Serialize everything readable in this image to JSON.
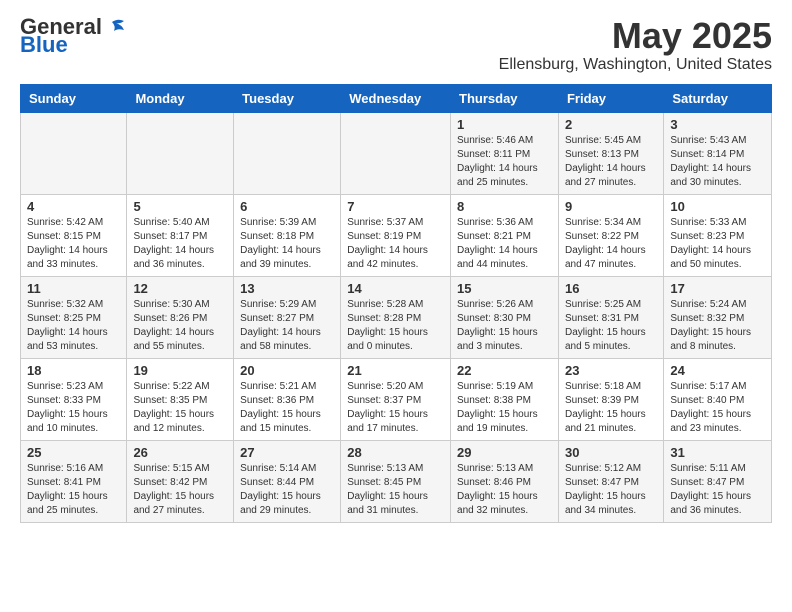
{
  "header": {
    "logo_general": "General",
    "logo_blue": "Blue",
    "month_title": "May 2025",
    "location": "Ellensburg, Washington, United States"
  },
  "days_of_week": [
    "Sunday",
    "Monday",
    "Tuesday",
    "Wednesday",
    "Thursday",
    "Friday",
    "Saturday"
  ],
  "weeks": [
    [
      {
        "num": "",
        "info": ""
      },
      {
        "num": "",
        "info": ""
      },
      {
        "num": "",
        "info": ""
      },
      {
        "num": "",
        "info": ""
      },
      {
        "num": "1",
        "info": "Sunrise: 5:46 AM\nSunset: 8:11 PM\nDaylight: 14 hours\nand 25 minutes."
      },
      {
        "num": "2",
        "info": "Sunrise: 5:45 AM\nSunset: 8:13 PM\nDaylight: 14 hours\nand 27 minutes."
      },
      {
        "num": "3",
        "info": "Sunrise: 5:43 AM\nSunset: 8:14 PM\nDaylight: 14 hours\nand 30 minutes."
      }
    ],
    [
      {
        "num": "4",
        "info": "Sunrise: 5:42 AM\nSunset: 8:15 PM\nDaylight: 14 hours\nand 33 minutes."
      },
      {
        "num": "5",
        "info": "Sunrise: 5:40 AM\nSunset: 8:17 PM\nDaylight: 14 hours\nand 36 minutes."
      },
      {
        "num": "6",
        "info": "Sunrise: 5:39 AM\nSunset: 8:18 PM\nDaylight: 14 hours\nand 39 minutes."
      },
      {
        "num": "7",
        "info": "Sunrise: 5:37 AM\nSunset: 8:19 PM\nDaylight: 14 hours\nand 42 minutes."
      },
      {
        "num": "8",
        "info": "Sunrise: 5:36 AM\nSunset: 8:21 PM\nDaylight: 14 hours\nand 44 minutes."
      },
      {
        "num": "9",
        "info": "Sunrise: 5:34 AM\nSunset: 8:22 PM\nDaylight: 14 hours\nand 47 minutes."
      },
      {
        "num": "10",
        "info": "Sunrise: 5:33 AM\nSunset: 8:23 PM\nDaylight: 14 hours\nand 50 minutes."
      }
    ],
    [
      {
        "num": "11",
        "info": "Sunrise: 5:32 AM\nSunset: 8:25 PM\nDaylight: 14 hours\nand 53 minutes."
      },
      {
        "num": "12",
        "info": "Sunrise: 5:30 AM\nSunset: 8:26 PM\nDaylight: 14 hours\nand 55 minutes."
      },
      {
        "num": "13",
        "info": "Sunrise: 5:29 AM\nSunset: 8:27 PM\nDaylight: 14 hours\nand 58 minutes."
      },
      {
        "num": "14",
        "info": "Sunrise: 5:28 AM\nSunset: 8:28 PM\nDaylight: 15 hours\nand 0 minutes."
      },
      {
        "num": "15",
        "info": "Sunrise: 5:26 AM\nSunset: 8:30 PM\nDaylight: 15 hours\nand 3 minutes."
      },
      {
        "num": "16",
        "info": "Sunrise: 5:25 AM\nSunset: 8:31 PM\nDaylight: 15 hours\nand 5 minutes."
      },
      {
        "num": "17",
        "info": "Sunrise: 5:24 AM\nSunset: 8:32 PM\nDaylight: 15 hours\nand 8 minutes."
      }
    ],
    [
      {
        "num": "18",
        "info": "Sunrise: 5:23 AM\nSunset: 8:33 PM\nDaylight: 15 hours\nand 10 minutes."
      },
      {
        "num": "19",
        "info": "Sunrise: 5:22 AM\nSunset: 8:35 PM\nDaylight: 15 hours\nand 12 minutes."
      },
      {
        "num": "20",
        "info": "Sunrise: 5:21 AM\nSunset: 8:36 PM\nDaylight: 15 hours\nand 15 minutes."
      },
      {
        "num": "21",
        "info": "Sunrise: 5:20 AM\nSunset: 8:37 PM\nDaylight: 15 hours\nand 17 minutes."
      },
      {
        "num": "22",
        "info": "Sunrise: 5:19 AM\nSunset: 8:38 PM\nDaylight: 15 hours\nand 19 minutes."
      },
      {
        "num": "23",
        "info": "Sunrise: 5:18 AM\nSunset: 8:39 PM\nDaylight: 15 hours\nand 21 minutes."
      },
      {
        "num": "24",
        "info": "Sunrise: 5:17 AM\nSunset: 8:40 PM\nDaylight: 15 hours\nand 23 minutes."
      }
    ],
    [
      {
        "num": "25",
        "info": "Sunrise: 5:16 AM\nSunset: 8:41 PM\nDaylight: 15 hours\nand 25 minutes."
      },
      {
        "num": "26",
        "info": "Sunrise: 5:15 AM\nSunset: 8:42 PM\nDaylight: 15 hours\nand 27 minutes."
      },
      {
        "num": "27",
        "info": "Sunrise: 5:14 AM\nSunset: 8:44 PM\nDaylight: 15 hours\nand 29 minutes."
      },
      {
        "num": "28",
        "info": "Sunrise: 5:13 AM\nSunset: 8:45 PM\nDaylight: 15 hours\nand 31 minutes."
      },
      {
        "num": "29",
        "info": "Sunrise: 5:13 AM\nSunset: 8:46 PM\nDaylight: 15 hours\nand 32 minutes."
      },
      {
        "num": "30",
        "info": "Sunrise: 5:12 AM\nSunset: 8:47 PM\nDaylight: 15 hours\nand 34 minutes."
      },
      {
        "num": "31",
        "info": "Sunrise: 5:11 AM\nSunset: 8:47 PM\nDaylight: 15 hours\nand 36 minutes."
      }
    ]
  ]
}
